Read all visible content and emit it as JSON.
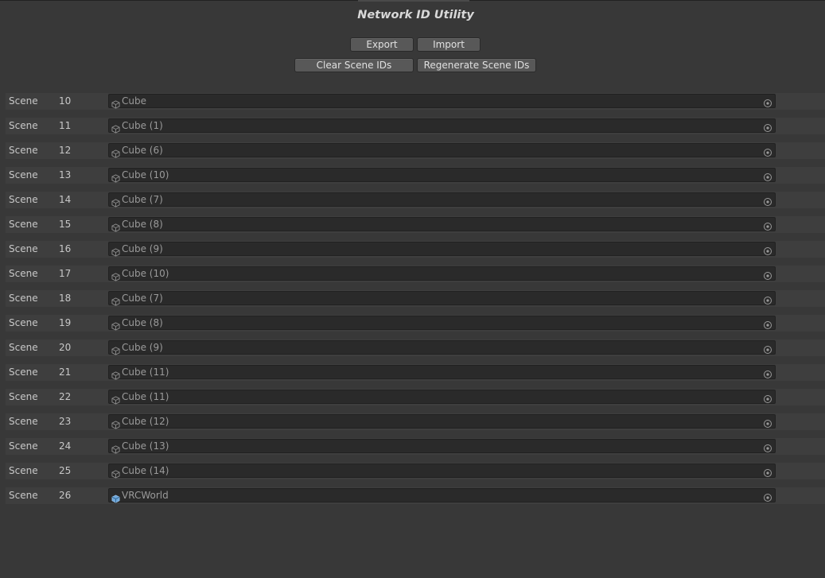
{
  "window": {
    "title": "Network ID Utility"
  },
  "toolbar": {
    "export_label": "Export",
    "import_label": "Import",
    "clear_label": "Clear Scene IDs",
    "regenerate_label": "Regenerate Scene IDs"
  },
  "rows": [
    {
      "label": "Scene",
      "id": "10",
      "object": "Cube",
      "icon": "cube-icon"
    },
    {
      "label": "Scene",
      "id": "11",
      "object": "Cube (1)",
      "icon": "cube-icon"
    },
    {
      "label": "Scene",
      "id": "12",
      "object": "Cube (6)",
      "icon": "cube-icon"
    },
    {
      "label": "Scene",
      "id": "13",
      "object": "Cube (10)",
      "icon": "cube-icon"
    },
    {
      "label": "Scene",
      "id": "14",
      "object": "Cube (7)",
      "icon": "cube-icon"
    },
    {
      "label": "Scene",
      "id": "15",
      "object": "Cube (8)",
      "icon": "cube-icon"
    },
    {
      "label": "Scene",
      "id": "16",
      "object": "Cube (9)",
      "icon": "cube-icon"
    },
    {
      "label": "Scene",
      "id": "17",
      "object": "Cube (10)",
      "icon": "cube-icon"
    },
    {
      "label": "Scene",
      "id": "18",
      "object": "Cube (7)",
      "icon": "cube-icon"
    },
    {
      "label": "Scene",
      "id": "19",
      "object": "Cube (8)",
      "icon": "cube-icon"
    },
    {
      "label": "Scene",
      "id": "20",
      "object": "Cube (9)",
      "icon": "cube-icon"
    },
    {
      "label": "Scene",
      "id": "21",
      "object": "Cube (11)",
      "icon": "cube-icon"
    },
    {
      "label": "Scene",
      "id": "22",
      "object": "Cube (11)",
      "icon": "cube-icon"
    },
    {
      "label": "Scene",
      "id": "23",
      "object": "Cube (12)",
      "icon": "cube-icon"
    },
    {
      "label": "Scene",
      "id": "24",
      "object": "Cube (13)",
      "icon": "cube-icon"
    },
    {
      "label": "Scene",
      "id": "25",
      "object": "Cube (14)",
      "icon": "cube-icon"
    },
    {
      "label": "Scene",
      "id": "26",
      "object": "VRCWorld",
      "icon": "prefab-icon"
    }
  ],
  "colors": {
    "background": "#383838",
    "field": "#2a2a2a",
    "button": "#585858",
    "prefab_icon": "#6fa8dc"
  }
}
